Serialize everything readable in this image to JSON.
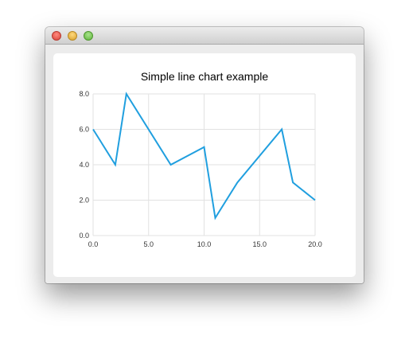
{
  "window": {
    "title": ""
  },
  "colors": {
    "series": "#209fdf",
    "grid": "#e2e2e2",
    "text": "#000000",
    "tick_text": "#333333"
  },
  "chart_data": {
    "type": "line",
    "title": "Simple line chart example",
    "xlabel": "",
    "ylabel": "",
    "xlim": [
      0,
      20
    ],
    "ylim": [
      0,
      8
    ],
    "x_ticks": [
      "0.0",
      "5.0",
      "10.0",
      "15.0",
      "20.0"
    ],
    "y_ticks": [
      "0.0",
      "2.0",
      "4.0",
      "6.0",
      "8.0"
    ],
    "grid": true,
    "legend": "none",
    "series": [
      {
        "x": [
          0,
          2,
          3,
          7,
          10,
          11,
          13,
          17,
          18,
          20
        ],
        "y": [
          6,
          4,
          8,
          4,
          5,
          1,
          3,
          6,
          3,
          2
        ]
      }
    ]
  }
}
